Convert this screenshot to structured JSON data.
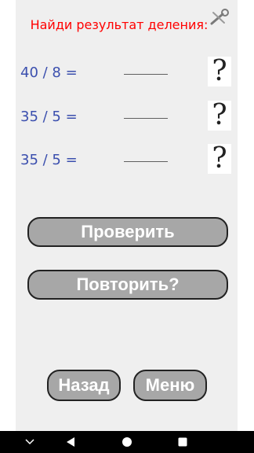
{
  "header": {
    "title": "Найди результат деления:"
  },
  "problems": [
    {
      "expression": "40 / 8 =",
      "answer": "",
      "hint": "?"
    },
    {
      "expression": "35 / 5 =",
      "answer": "",
      "hint": "?"
    },
    {
      "expression": "35 / 5 =",
      "answer": "",
      "hint": "?"
    }
  ],
  "buttons": {
    "check": "Проверить",
    "repeat": "Повторить?",
    "back": "Назад",
    "menu": "Меню"
  },
  "icons": {
    "settings": "wrench-screwdriver-icon",
    "nav_down": "chevron-down-icon",
    "nav_back": "triangle-back-icon",
    "nav_home": "circle-home-icon",
    "nav_recents": "square-recents-icon"
  },
  "colors": {
    "title": "#ff0000",
    "expression": "#3b4fae",
    "button_fill": "#a7a7a7",
    "background": "#efefef"
  }
}
